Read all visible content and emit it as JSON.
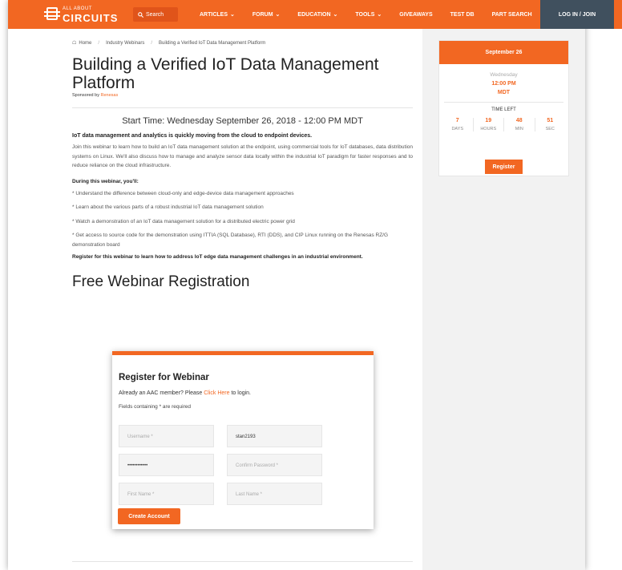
{
  "header": {
    "logo_small": "ALL ABOUT",
    "logo_big": "CIRCUITS",
    "search_placeholder": "Search",
    "nav": [
      {
        "label": "ARTICLES",
        "dropdown": true
      },
      {
        "label": "FORUM",
        "dropdown": true
      },
      {
        "label": "EDUCATION",
        "dropdown": true
      },
      {
        "label": "TOOLS",
        "dropdown": true
      },
      {
        "label": "GIVEAWAYS",
        "dropdown": false
      },
      {
        "label": "TEST DB",
        "dropdown": false
      },
      {
        "label": "PART SEARCH",
        "dropdown": false
      }
    ],
    "login": "LOG IN / JOIN"
  },
  "breadcrumb": {
    "home": "Home",
    "section": "Industry Webinars",
    "current": "Building a Verified IoT Data Management Platform"
  },
  "article": {
    "title": "Building a Verified IoT Data Management Platform",
    "sponsor_prefix": "Sponsored by",
    "sponsor": "Renesas",
    "start_time": "Start Time: Wednesday September 26, 2018 - 12:00 PM MDT",
    "lead": "IoT data management and analytics is quickly moving from the cloud to endpoint devices.",
    "body": "Join this webinar to learn how to build an IoT data management solution at the endpoint, using commercial tools for IoT databases, data distribution systems on Linux. We'll also discuss how to manage and analyze sensor data locally within the industrial IoT paradigm for faster responses and to reduce reliance on the cloud infrastructure.",
    "during": "During this webinar, you'll:",
    "bullets": [
      "* Understand the difference between cloud-only and edge-device data management approaches",
      "* Learn about the various parts of a robust industrial IoT data management solution",
      "* Watch a demonstration of an IoT data management solution for a distributed electric power grid",
      "* Get access to source code for the demonstration using ITTIA (SQL Database), RTI (DDS), and CIP Linux running on the Renesas RZ/G demonstration board"
    ],
    "closing": "Register for this webinar to learn how to address IoT edge data management challenges in an industrial environment.",
    "registration_heading": "Free Webinar Registration"
  },
  "form": {
    "title": "Register for Webinar",
    "note_prefix": "Already an AAC member? Please",
    "note_link": "Click Here",
    "note_suffix": "to login.",
    "required_note": "Fields containing * are required",
    "username_placeholder": "Username *",
    "username_value": "stan2193",
    "password_value": "••••••••••••",
    "confirm_placeholder": "Confirm Password *",
    "first_placeholder": "First Name *",
    "last_placeholder": "Last Name *",
    "submit": "Create Account"
  },
  "countdown": {
    "date": "September 26",
    "weekday": "Wednesday",
    "time": "12:00 PM",
    "tz": "MDT",
    "time_left": "TIME LEFT",
    "units": [
      {
        "num": "7",
        "label": "DAYS"
      },
      {
        "num": "19",
        "label": "HOURS"
      },
      {
        "num": "48",
        "label": "MIN"
      },
      {
        "num": "51",
        "label": "SEC"
      }
    ],
    "register": "Register"
  },
  "colors": {
    "accent": "#f26722",
    "login_bg": "#40505e",
    "sidebar_bg": "#f2f2f2"
  }
}
